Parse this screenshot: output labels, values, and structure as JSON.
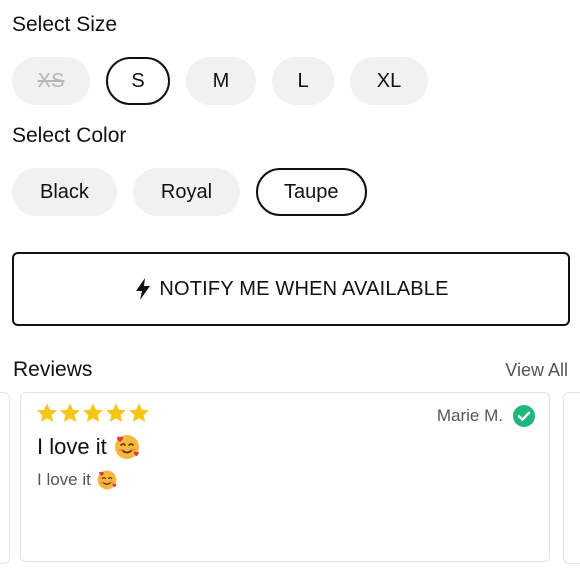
{
  "size_section": {
    "title": "Select Size",
    "options": [
      {
        "label": "XS",
        "state": "unavailable"
      },
      {
        "label": "S",
        "state": "selected"
      },
      {
        "label": "M",
        "state": "available"
      },
      {
        "label": "L",
        "state": "available"
      },
      {
        "label": "XL",
        "state": "available"
      }
    ]
  },
  "color_section": {
    "title": "Select Color",
    "options": [
      {
        "label": "Black",
        "state": "available"
      },
      {
        "label": "Royal",
        "state": "available"
      },
      {
        "label": "Taupe",
        "state": "selected"
      }
    ]
  },
  "notify_button": {
    "label": "NOTIFY ME WHEN AVAILABLE",
    "icon": "lightning-bolt-icon"
  },
  "reviews": {
    "title": "Reviews",
    "view_all_label": "View All",
    "items": [
      {
        "rating": 5,
        "author": "Marie M.",
        "verified": true,
        "title": "I love it",
        "body": "I love it",
        "emoji_icon": "smiling-face-with-hearts-icon"
      }
    ]
  },
  "colors": {
    "star": "#f5c518",
    "verified": "#1fb67a",
    "border": "#111111",
    "chip_bg": "#f1f1f1"
  }
}
